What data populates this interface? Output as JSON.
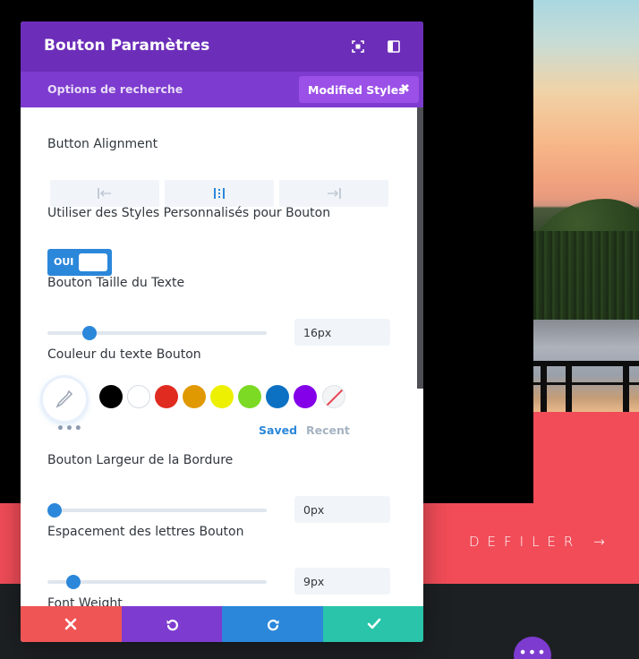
{
  "modal": {
    "title": "Bouton Paramètres",
    "header_icons": [
      "fullscreen-icon",
      "split-view-icon"
    ],
    "subbar": {
      "search_options_label": "Options de recherche",
      "modified_styles_label": "Modified Styles",
      "close_glyph": "✖"
    },
    "settings": {
      "button_alignment_label": "Button Alignment",
      "alignment_options": [
        "left-align-icon",
        "center-align-icon",
        "right-align-icon"
      ],
      "alignment_selected": "center",
      "custom_styles_label": "Utiliser des Styles Personnalisés pour Bouton",
      "custom_styles_toggle_text": "OUI",
      "text_size": {
        "label": "Bouton Taille du Texte",
        "value": "16px",
        "slider_fraction": 0.17
      },
      "text_color": {
        "label": "Couleur du texte Bouton",
        "picker_icon": "eyedropper-icon",
        "swatches": [
          "#000000",
          "#ffffff",
          "#e02b20",
          "#e09900",
          "#edf000",
          "#7cda24",
          "#0c71c3",
          "#8300e9"
        ],
        "none_swatch_icon": "no-color-icon",
        "more_glyph": "•••",
        "tab_saved": "Saved",
        "tab_recent": "Recent"
      },
      "border_width": {
        "label": "Bouton Largeur de la Bordure",
        "value": "0px",
        "slider_fraction": 0.0
      },
      "letter_spacing": {
        "label": "Espacement des lettres Bouton",
        "value": "9px",
        "slider_fraction": 0.09
      },
      "font_weight_label": "Font Weight"
    },
    "footer_icons": [
      "cancel-icon",
      "undo-icon",
      "redo-icon",
      "save-check-icon"
    ],
    "colors": {
      "header": "#6c2eb9",
      "subbar": "#7d3bcf",
      "badge": "#9b50e8",
      "accent": "#2b87da",
      "footer_cancel": "#ef5555",
      "footer_undo": "#7e3bd0",
      "footer_redo": "#2b87da",
      "footer_save": "#29c4a9"
    }
  },
  "page": {
    "scroll_link_text": "DEFILER →",
    "fab_glyph": "•••",
    "band_color": "#f14c58"
  }
}
